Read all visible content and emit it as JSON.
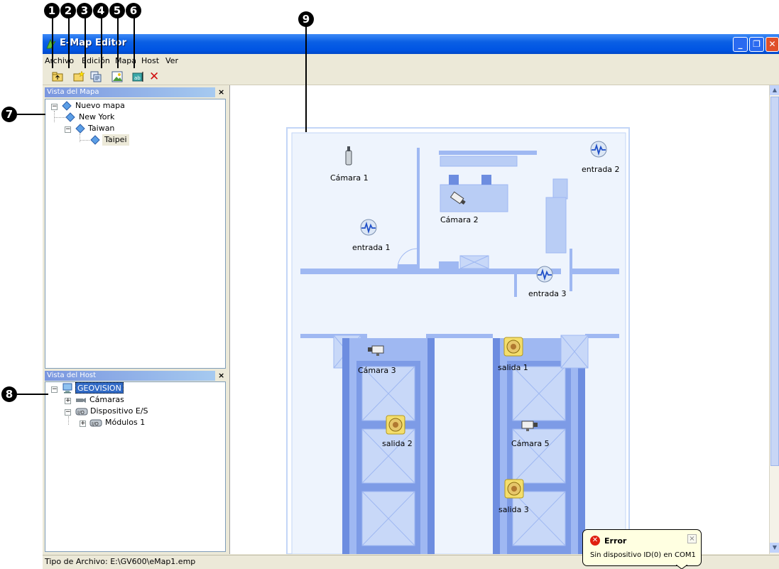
{
  "callouts": [
    "1",
    "2",
    "3",
    "4",
    "5",
    "6",
    "7",
    "8",
    "9"
  ],
  "window": {
    "title": "E-Map Editor",
    "controls": {
      "minimize": "_",
      "restore": "❐",
      "close": "✕"
    }
  },
  "menu": [
    "Archivo",
    "Edición",
    "Mapa",
    "Host",
    "Ver"
  ],
  "toolbar": {
    "buttons": [
      "up-folder-icon",
      "new-map-icon",
      "copy-map-icon",
      "map-image-icon",
      "label-icon",
      "delete-icon"
    ],
    "delete_glyph": "✕"
  },
  "map_view_pane": {
    "header": "Vista del Mapa",
    "close": "×",
    "tree": {
      "root": "Nuevo mapa",
      "children": [
        "New York",
        "Taiwan"
      ],
      "taiwan_children": [
        "Taipei"
      ],
      "selected": "Taipei"
    }
  },
  "host_view_pane": {
    "header": "Vista del Host",
    "close": "×",
    "tree": {
      "root": "GEOVISION",
      "children": [
        "Cámaras",
        "Dispositivo E/S"
      ],
      "io_children": [
        "Módulos 1"
      ]
    }
  },
  "map": {
    "labels": {
      "cam1": "Cámara 1",
      "cam2": "Cámara 2",
      "cam3": "Cámara 3",
      "cam5": "Cámara 5",
      "entrada1": "entrada 1",
      "entrada2": "entrada 2",
      "entrada3": "entrada 3",
      "salida1": "salida 1",
      "salida2": "salida 2",
      "salida3": "salida 3"
    },
    "colors": {
      "floor": "#eef4fd",
      "structure": "#9fb8f2",
      "dark": "#6d8de0",
      "border": "#c3d6f7"
    }
  },
  "status": {
    "text": "Tipo de Archivo: E:\\GV600\\eMap1.emp"
  },
  "error_popup": {
    "title": "Error",
    "message": "Sin dispositivo ID(0) en COM1",
    "close": "×"
  }
}
